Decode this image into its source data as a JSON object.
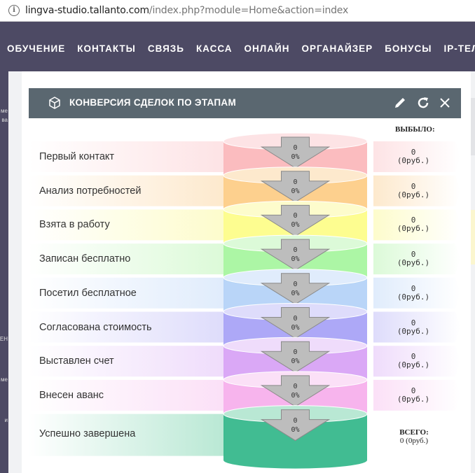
{
  "browser": {
    "url_host": "lingva-studio.tallanto.com",
    "url_path": "/index.php?module=Home&action=index"
  },
  "nav": {
    "items": [
      "ОБУЧЕНИЕ",
      "КОНТАКТЫ",
      "СВЯЗЬ",
      "КАССА",
      "ОНЛАЙН",
      "ОРГАНАЙЗЕР",
      "БОНУСЫ",
      "IP-ТЕЛ"
    ]
  },
  "sidebar": {
    "fragments": [
      "ме",
      "ва",
      "ЕН",
      "ме",
      "и"
    ]
  },
  "panel": {
    "title": "КОНВЕРСИЯ СДЕЛОК ПО ЭТАПАМ",
    "icons": [
      "cube-icon",
      "pencil-icon",
      "refresh-icon",
      "close-icon"
    ],
    "lost_header": "ВЫБЫЛО:",
    "stages": [
      {
        "label": "Первый контакт",
        "count": "0",
        "percent": "0%",
        "lost_count": "0",
        "lost_sum": "(0руб.)",
        "color": "#fbb8bc",
        "bar": "#fde3e5"
      },
      {
        "label": "Анализ потребностей",
        "count": "0",
        "percent": "0%",
        "lost_count": "0",
        "lost_sum": "(0руб.)",
        "color": "#fdcd88",
        "bar": "#fde9cd"
      },
      {
        "label": "Взята в работу",
        "count": "0",
        "percent": "0%",
        "lost_count": "0",
        "lost_sum": "(0руб.)",
        "color": "#fdfd8a",
        "bar": "#fdfccc"
      },
      {
        "label": "Записан бесплатно",
        "count": "0",
        "percent": "0%",
        "lost_count": "0",
        "lost_sum": "(0руб.)",
        "color": "#a8f5a0",
        "bar": "#dcfad8"
      },
      {
        "label": "Посетил бесплатное",
        "count": "0",
        "percent": "0%",
        "lost_count": "0",
        "lost_sum": "(0руб.)",
        "color": "#b5d3f8",
        "bar": "#e0ecfc"
      },
      {
        "label": "Согласована стоимость",
        "count": "0",
        "percent": "0%",
        "lost_count": "0",
        "lost_sum": "(0руб.)",
        "color": "#a9a3f7",
        "bar": "#dedcfb"
      },
      {
        "label": "Выставлен счет",
        "count": "0",
        "percent": "0%",
        "lost_count": "0",
        "lost_sum": "(0руб.)",
        "color": "#d8a3f5",
        "bar": "#efdcfb"
      },
      {
        "label": "Внесен аванс",
        "count": "0",
        "percent": "0%",
        "lost_count": "0",
        "lost_sum": "(0руб.)",
        "color": "#f7b0ec",
        "bar": "#fbe0f7"
      }
    ],
    "final": {
      "label": "Успешно завершена",
      "count": "0",
      "percent": "0%",
      "color": "#37b88c",
      "bar": "#b9e8d4"
    },
    "total_header": "ВСЕГО:",
    "total_value": "0 (0руб.)"
  }
}
